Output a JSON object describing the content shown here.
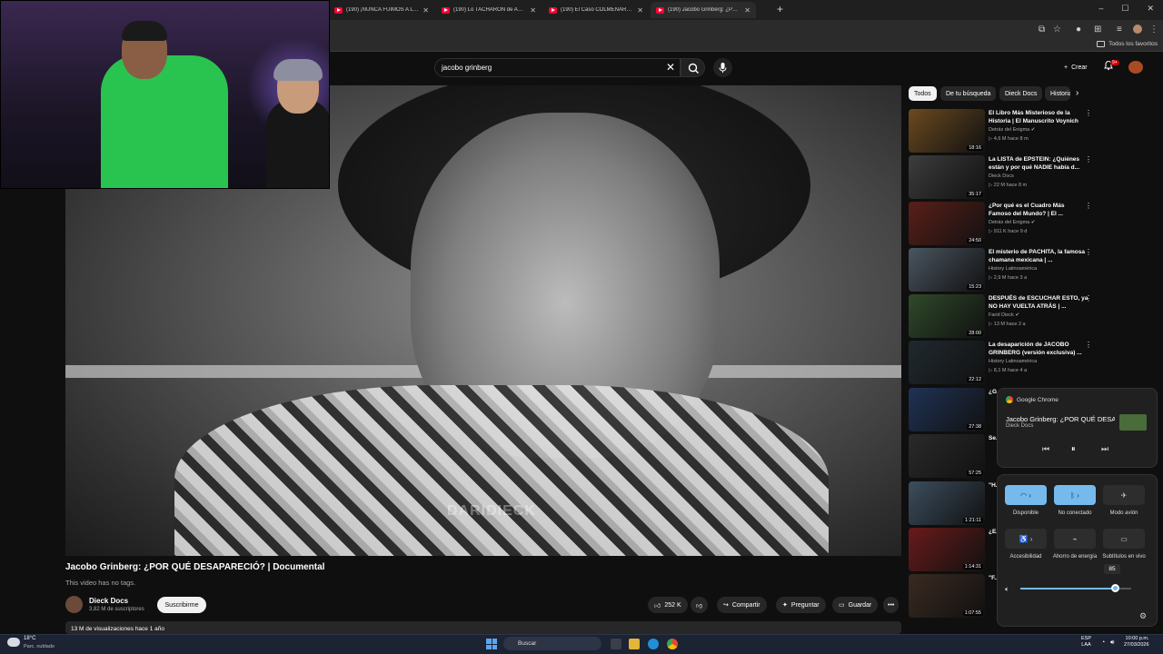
{
  "browser": {
    "tabs": [
      {
        "title": "(190) ¡NUNCA FUIMOS A LA LUNA"
      },
      {
        "title": "(190) Lo TACHARON de ARRIE..."
      },
      {
        "title": "(190) El Caso COLMENARES | C..."
      },
      {
        "title": "(190) Jacobo Grinberg: ¿POR Q..."
      }
    ],
    "new_tab": "+",
    "window_controls": [
      "–",
      "☐",
      "✕"
    ],
    "bookmarks_all": "Todos los favoritos"
  },
  "header": {
    "search_value": "jacobo grinberg",
    "clear": "✕",
    "create_label": "Crear",
    "notif_count": "9+"
  },
  "video": {
    "watermark": "DARIDIECK",
    "title": "Jacobo Grinberg: ¿POR QUÉ DESAPARECIÓ? | Documental",
    "tags_note": "This video has no tags.",
    "channel": "Dieck Docs",
    "subscribers": "3,82 M de suscriptores",
    "subscribe_label": "Suscribirme",
    "likes": "252 K",
    "share_label": "Compartir",
    "ask_label": "Preguntar",
    "save_label": "Guardar",
    "more": "•••",
    "views_line": "13 M de visualizaciones  hace 1 año"
  },
  "chips": [
    {
      "label": "Todos"
    },
    {
      "label": "De tu búsqueda"
    },
    {
      "label": "Dieck Docs"
    },
    {
      "label": "Historia"
    }
  ],
  "recommendations": [
    {
      "title": "El Libro Más Misterioso de la Historia | El Manuscrito Voynich",
      "channel": "Detrás del Enigma ✔",
      "meta": "▷ 4,6 M   hace 8 m",
      "duration": "18:16",
      "color": "#6b4a1f"
    },
    {
      "title": "La LISTA de EPSTEIN: ¿Quiénes están y por qué NADIE había d...",
      "channel": "Dieck Docs",
      "meta": "▷ 22 M   hace 8 m",
      "duration": "35:17",
      "color": "#3d3d3d"
    },
    {
      "title": "¿Por qué es el Cuadro Más Famoso del Mundo? | El ...",
      "channel": "Detrás del Enigma ✔",
      "meta": "▷ 911 K   hace 9 d",
      "duration": "24:50",
      "color": "#5a1f18"
    },
    {
      "title": "El misterio de PACHITA, la famosa chamana mexicana | ...",
      "channel": "History Latinoamérica",
      "meta": "▷ 2,9 M   hace 3 a",
      "duration": "15:23",
      "color": "#4a5560"
    },
    {
      "title": "DESPUÉS de ESCUCHAR ESTO, ya NO HAY VUELTA ATRÁS | ...",
      "channel": "Farid Dieck ✔",
      "meta": "▷ 13 M   hace 2 a",
      "duration": "28:00",
      "color": "#2f4a2a"
    },
    {
      "title": "La desaparición de JACOBO GRINBERG (versión exclusiva) ...",
      "channel": "History Latinoamérica",
      "meta": "▷ 8,1 M   hace 4 a",
      "duration": "22:12",
      "color": "#20292f"
    },
    {
      "title": "¿G...",
      "channel": "",
      "meta": "",
      "duration": "27:38",
      "color": "#1f3355"
    },
    {
      "title": "Se...",
      "channel": "",
      "meta": "",
      "duration": "57:25",
      "color": "#2a2a2a"
    },
    {
      "title": "\"H...",
      "channel": "",
      "meta": "",
      "duration": "1:21:11",
      "color": "#3c4e5e"
    },
    {
      "title": "¿E...",
      "channel": "",
      "meta": "",
      "duration": "1:14:31",
      "color": "#6a1a1a"
    },
    {
      "title": "\"F...",
      "channel": "",
      "meta": "",
      "duration": "1:07:55",
      "color": "#3a2a20"
    }
  ],
  "media_popup": {
    "source": "Google Chrome",
    "title": "Jacobo Grinberg: ¿POR QUÉ DESAP...",
    "artist": "Dieck Docs"
  },
  "quick_settings": {
    "tiles": [
      {
        "label": "Disponible",
        "icon": "wifi-icon",
        "on": true
      },
      {
        "label": "No conectado",
        "icon": "bluetooth-icon",
        "on": true
      },
      {
        "label": "Modo avión",
        "icon": "airplane-icon",
        "on": false
      },
      {
        "label": "Accesibilidad",
        "icon": "accessibility-icon",
        "on": false
      },
      {
        "label": "Ahorro de energía",
        "icon": "energy-saver-icon",
        "on": false
      },
      {
        "label": "Subtítulos en vivo",
        "icon": "live-captions-icon",
        "on": false
      }
    ],
    "volume": 85,
    "volume_display": "85"
  },
  "taskbar": {
    "temp": "18°C",
    "weather": "Parc. nublado",
    "search_placeholder": "Buscar",
    "lang1": "ESP",
    "lang2": "LAA",
    "time": "10:00 p.m.",
    "date": "27/03/2026"
  }
}
